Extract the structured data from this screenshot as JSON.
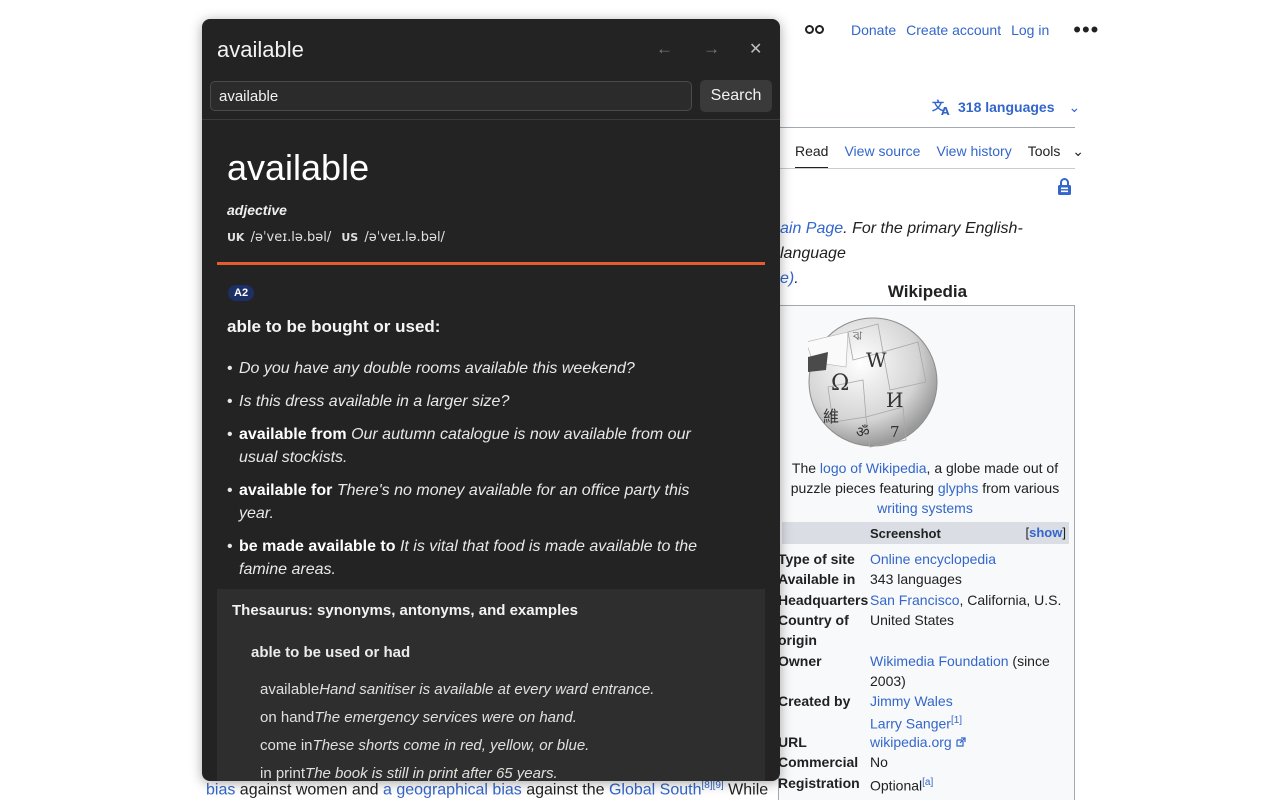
{
  "wiki": {
    "header": {
      "donate": "Donate",
      "create_account": "Create account",
      "log_in": "Log in",
      "more": "•••"
    },
    "languages": {
      "label": "318 languages",
      "chevron": "⌄"
    },
    "tabs": {
      "read": "Read",
      "view_source": "View source",
      "view_history": "View history",
      "tools": "Tools"
    },
    "hatnote": {
      "link1": "ain Page",
      "text1": ". For the primary English-language",
      "link2": "e)",
      "text2": "."
    },
    "infobox": {
      "title": "Wikipedia",
      "caption": {
        "pre": "The ",
        "link1": "logo of Wikipedia",
        "mid1": ", a globe made out of puzzle pieces featuring ",
        "link2": "glyphs",
        "mid2": " from various ",
        "link3": "writing systems"
      },
      "screenshot_label": "Screenshot",
      "show_link": "show",
      "rows": [
        {
          "key": "Type of site",
          "value": "Online encyclopedia",
          "link": true
        },
        {
          "key": "Available in",
          "value": "343 languages",
          "link": false
        },
        {
          "key": "Headquarters",
          "value_link": "San Francisco",
          "value_rest": ", California, U.S."
        },
        {
          "key": "Country of origin",
          "value": "United States",
          "link": false
        },
        {
          "key": "Owner",
          "value_link": "Wikimedia Foundation",
          "value_rest": " (since 2003)"
        },
        {
          "key": "Created by",
          "value_link": "Jimmy Wales",
          "value_link2": "Larry Sanger",
          "sup": "[1]"
        },
        {
          "key": "URL",
          "value": "wikipedia.org",
          "link": true
        },
        {
          "key": "Commercial",
          "value": "No",
          "link": false
        },
        {
          "key": "Registration",
          "value": "Optional",
          "sup": "[a]"
        }
      ]
    },
    "bottom": {
      "link1": "bias",
      "text1": " against women and ",
      "link2": "a geographical bias",
      "text2": " against the ",
      "link3": "Global South",
      "sup": "[8][9]",
      "text3": " While"
    }
  },
  "popup": {
    "title": "available",
    "back_arrow": "←",
    "forward_arrow": "→",
    "close": "✕",
    "search_value": "available",
    "search_button": "Search",
    "entry": {
      "word": "available",
      "part_of_speech": "adjective",
      "uk_label": "UK",
      "uk_ipa": "/əˈveɪ.lə.bəl/",
      "us_label": "US",
      "us_ipa": "/əˈveɪ.lə.bəl/",
      "level": "A2",
      "sense": "able to be bought or used:",
      "examples": [
        {
          "bold": "",
          "text": "Do you have any double rooms available this weekend?"
        },
        {
          "bold": "",
          "text": "Is this dress available in a larger size?"
        },
        {
          "bold": "available from",
          "text": "Our autumn catalogue is now available from our usual stockists."
        },
        {
          "bold": "available for",
          "text": "There's no money available for an office party this year."
        },
        {
          "bold": "be made available to",
          "text": "It is vital that food is made available to the famine areas."
        }
      ]
    },
    "thesaurus": {
      "title": "Thesaurus: synonyms, antonyms, and examples",
      "subheading": "able to be used or had",
      "items": [
        {
          "word": "available",
          "example": "Hand sanitiser is available at every ward entrance."
        },
        {
          "word": "on hand",
          "example": "The emergency services were on hand."
        },
        {
          "word": "come in",
          "example": "These shorts come in red, yellow, or blue."
        },
        {
          "word": "in print",
          "example": "The book is still in print after 65 years."
        }
      ]
    }
  },
  "colors": {
    "link": "#3366cc",
    "popup_bg": "#232323",
    "accent_rule": "#e25e2e",
    "level_badge": "#1e2f66"
  }
}
